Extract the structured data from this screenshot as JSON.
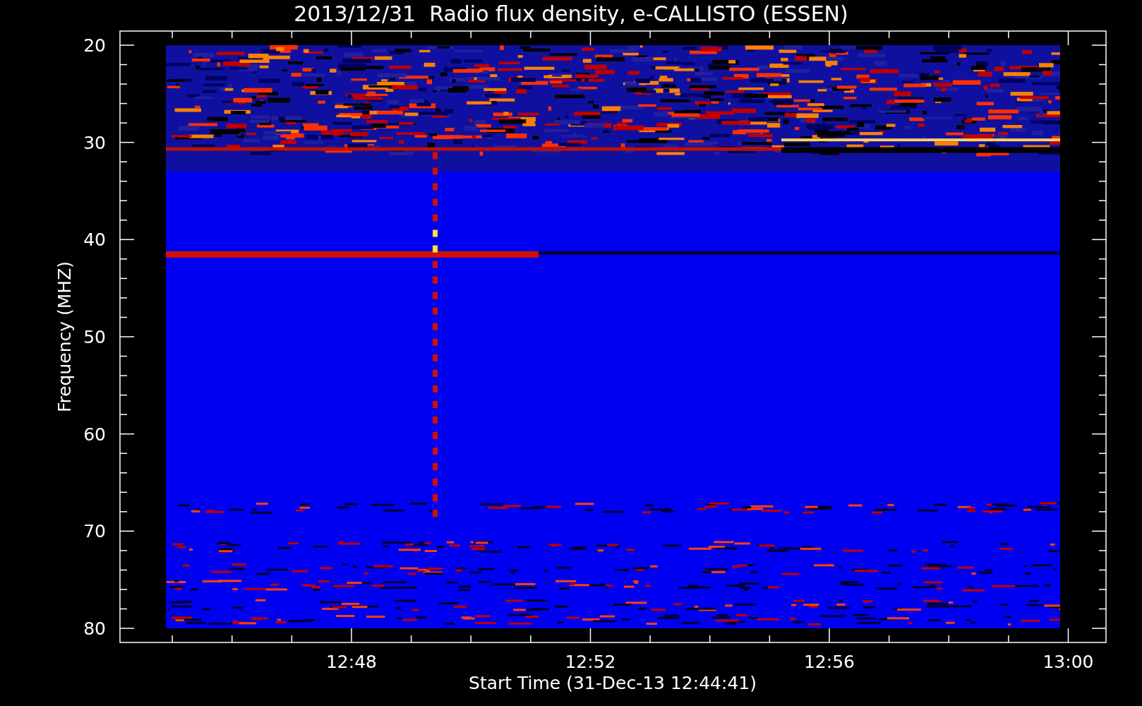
{
  "title": "2013/12/31  Radio flux density, e-CALLISTO (ESSEN)",
  "y_axis": {
    "label": "Frequency (MHZ)",
    "ticks": [
      "20",
      "30",
      "40",
      "50",
      "60",
      "70",
      "80"
    ]
  },
  "x_axis": {
    "label": "Start Time (31-Dec-13 12:44:41)",
    "ticks": [
      "12:48",
      "12:52",
      "12:56",
      "13:00"
    ]
  }
}
